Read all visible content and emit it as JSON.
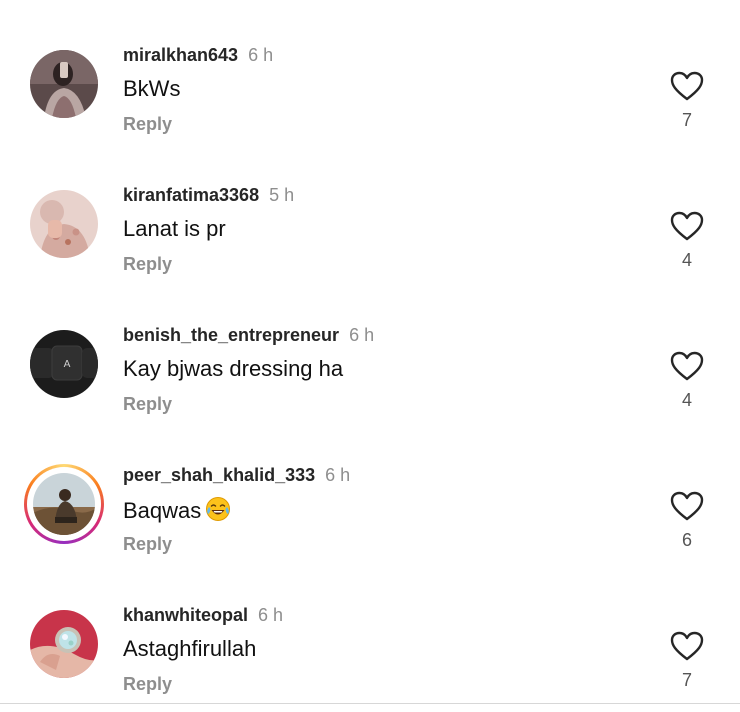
{
  "comments": [
    {
      "username": "miralkhan643",
      "time": "6 h",
      "text": "BkWs",
      "reply_label": "Reply",
      "likes": "7",
      "avatar_icon": "profile-photo",
      "story_ring": false
    },
    {
      "username": "kiranfatima3368",
      "time": "5 h",
      "text": "Lanat is pr",
      "reply_label": "Reply",
      "likes": "4",
      "avatar_icon": "profile-photo",
      "story_ring": false
    },
    {
      "username": "benish_the_entrepreneur",
      "time": "6 h",
      "text": "Kay bjwas dressing ha",
      "reply_label": "Reply",
      "likes": "4",
      "avatar_icon": "profile-photo",
      "story_ring": false
    },
    {
      "username": "peer_shah_khalid_333",
      "time": "6 h",
      "text": "Baqwas",
      "emoji": "face-with-tears-of-joy",
      "reply_label": "Reply",
      "likes": "6",
      "avatar_icon": "profile-photo",
      "story_ring": true
    },
    {
      "username": "khanwhiteopal",
      "time": "6 h",
      "text": "Astaghfirullah",
      "reply_label": "Reply",
      "likes": "7",
      "avatar_icon": "profile-photo",
      "story_ring": false
    }
  ],
  "icons": {
    "like": "heart-outline-icon"
  },
  "colors": {
    "username": "#262626",
    "secondary_text": "#8e8e8e",
    "icon": "#262626",
    "story_ring": [
      "#feda75",
      "#fa7e1e",
      "#d62976",
      "#962fbf"
    ]
  }
}
